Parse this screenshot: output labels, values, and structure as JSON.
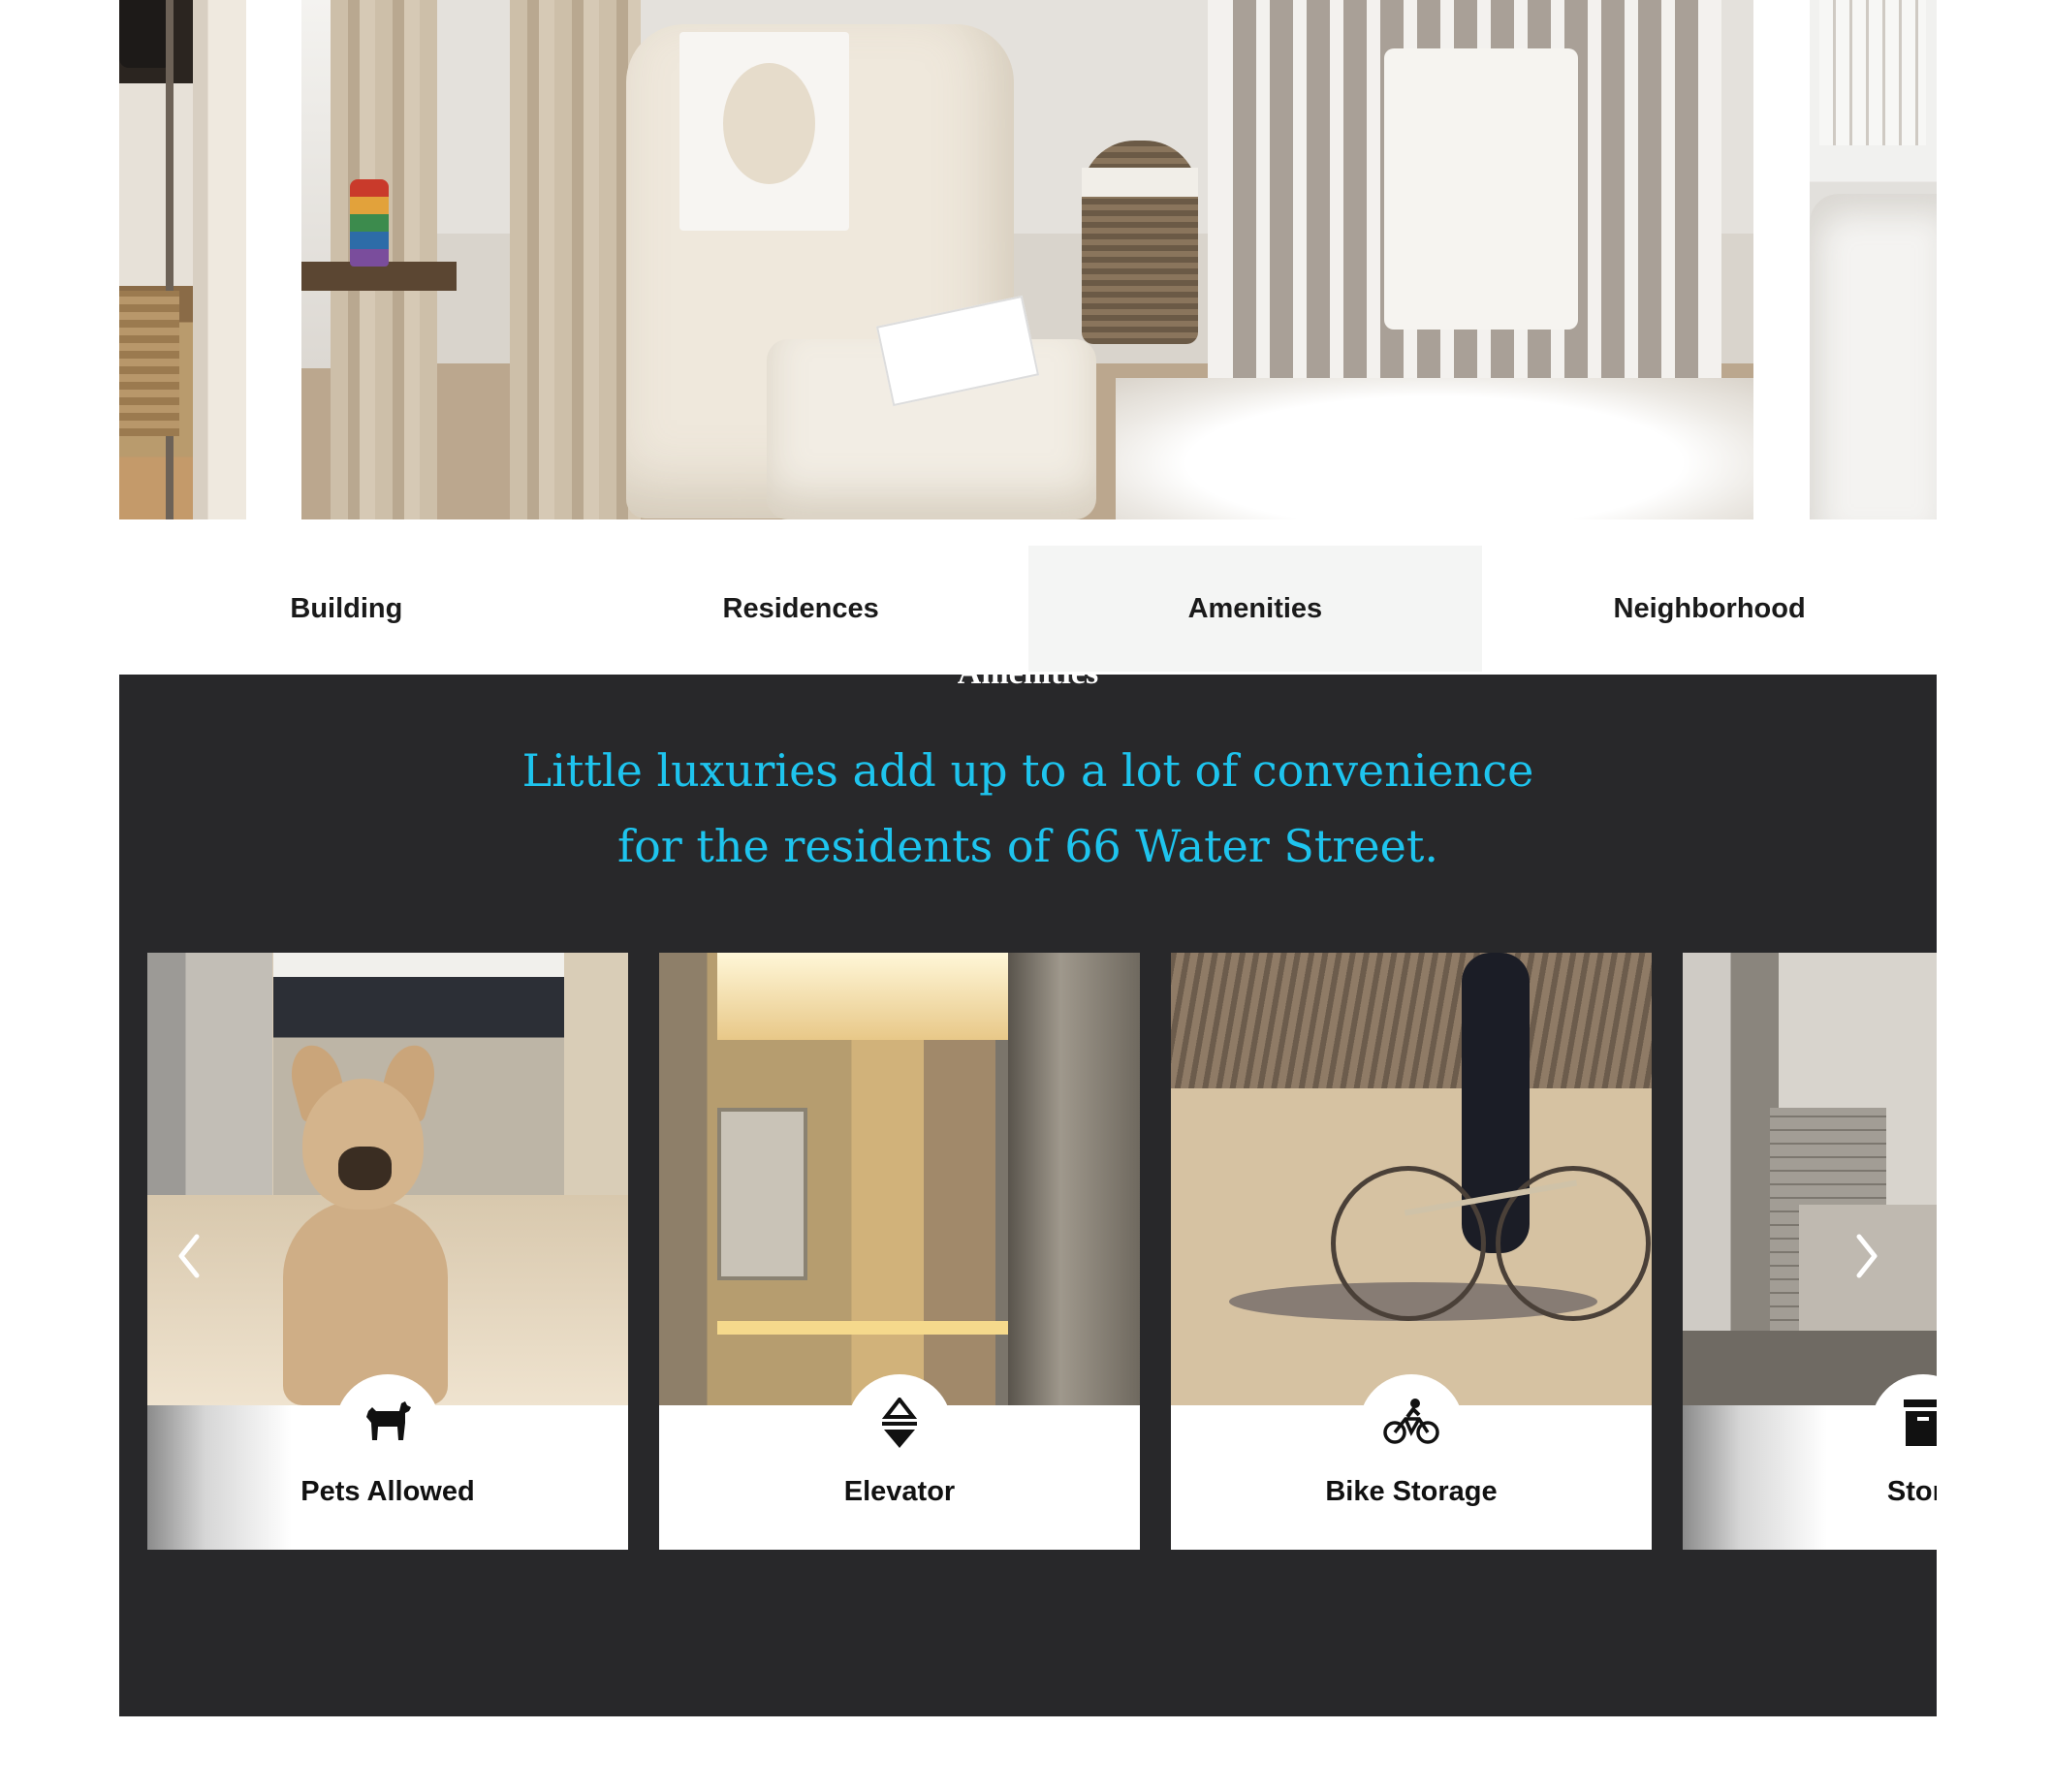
{
  "gallery": {
    "images": [
      {
        "name": "hallway-coat-rack"
      },
      {
        "name": "nursery-room"
      },
      {
        "name": "living-room"
      }
    ]
  },
  "tabs": [
    {
      "label": "Building",
      "active": false
    },
    {
      "label": "Residences",
      "active": false
    },
    {
      "label": "Amenities",
      "active": true
    },
    {
      "label": "Neighborhood",
      "active": false
    }
  ],
  "amenities": {
    "section_title": "Amenities",
    "tagline": "Little luxuries add up to a lot of convenience for the residents of 66 Water Street.",
    "cards": [
      {
        "label": "Pets Allowed",
        "icon": "dog-icon"
      },
      {
        "label": "Elevator",
        "icon": "elevator-icon"
      },
      {
        "label": "Bike Storage",
        "icon": "bicycle-icon"
      },
      {
        "label": "Stora",
        "icon": "storage-box-icon"
      }
    ],
    "prev_icon": "chevron-left-icon",
    "next_icon": "chevron-right-icon"
  },
  "colors": {
    "section_bg": "#28282a",
    "tagline": "#1ec4ee",
    "active_tab_bg": "#f4f5f4"
  }
}
